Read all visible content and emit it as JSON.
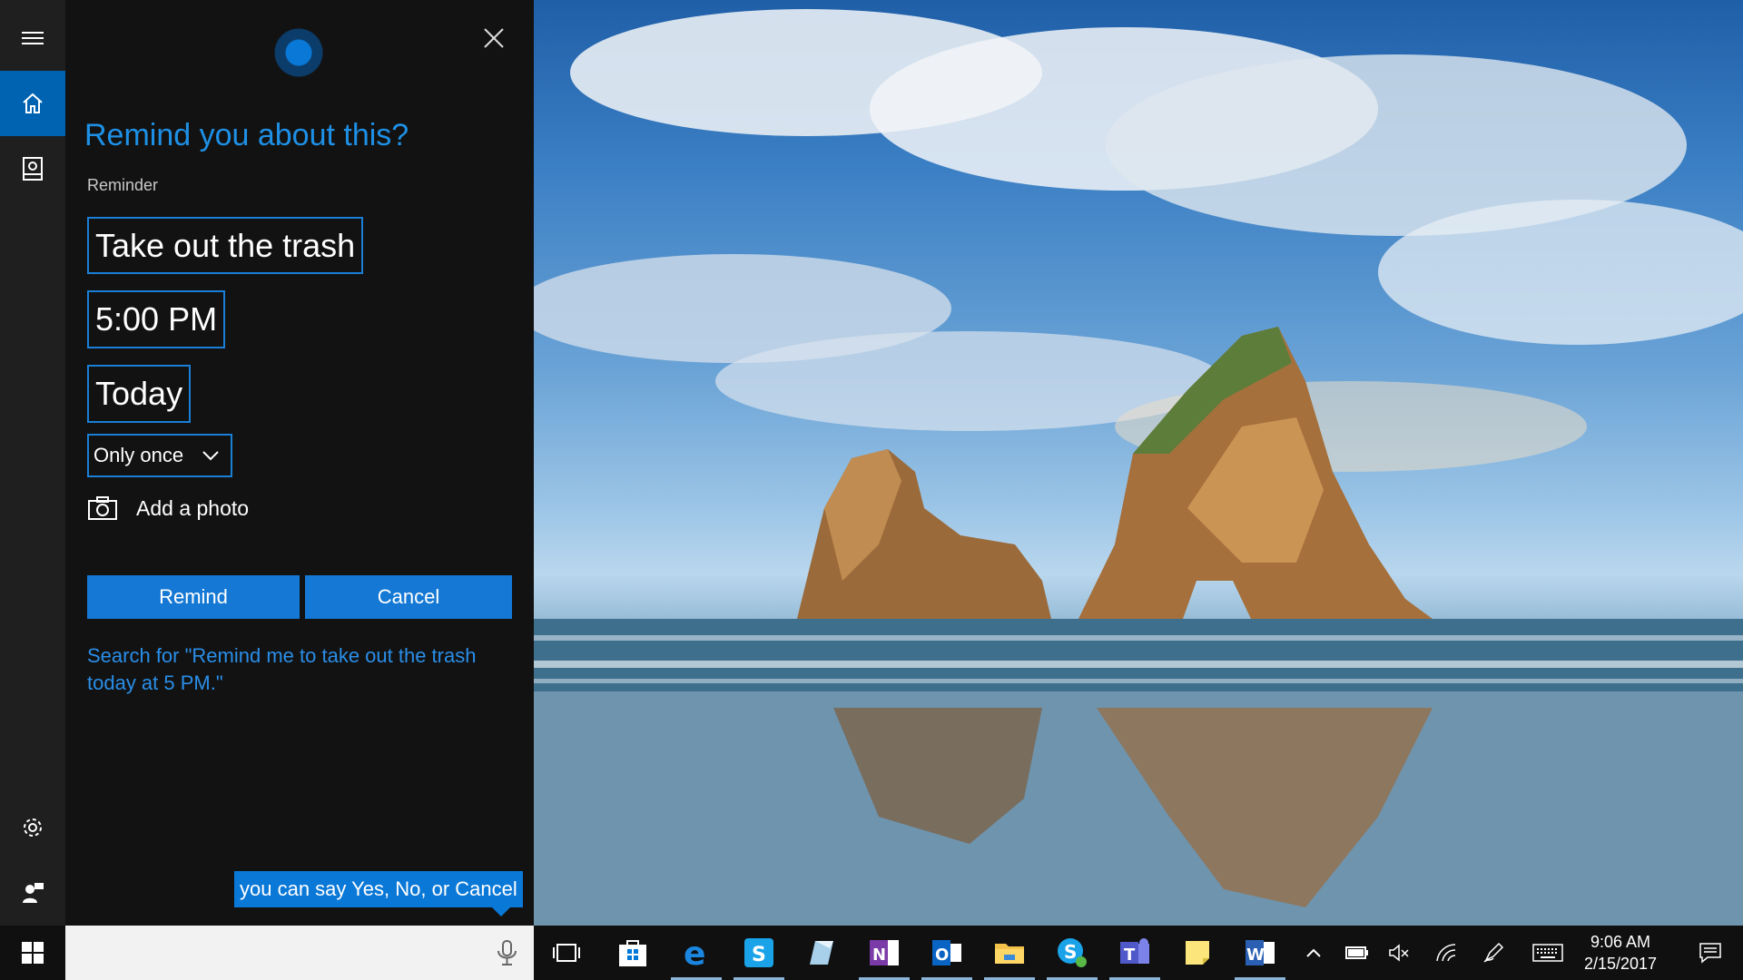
{
  "cortana": {
    "title": "Remind you about this?",
    "section_label": "Reminder",
    "task_value": "Take out the trash",
    "time_value": "5:00 PM",
    "day_value": "Today",
    "repeat_value": "Only once",
    "add_photo_label": "Add a photo",
    "remind_label": "Remind",
    "cancel_label": "Cancel",
    "search_hint": "Search for \"Remind me to take out the trash today at 5 PM.\"",
    "speech_tip": "you can say Yes, No, or Cancel"
  },
  "rail": {
    "items": [
      {
        "icon": "hamburger-menu-icon"
      },
      {
        "icon": "home-icon",
        "active": true
      },
      {
        "icon": "notebook-icon"
      },
      {
        "icon": "gear-icon"
      },
      {
        "icon": "feedback-icon"
      }
    ]
  },
  "taskbar": {
    "pinned": [
      "task-view-icon",
      "store-icon",
      "edge-icon",
      "skype-icon",
      "paint3d-icon",
      "onenote-icon",
      "outlook-icon",
      "file-explorer-icon",
      "skype-business-icon",
      "teams-icon",
      "sticky-notes-icon",
      "word-icon"
    ],
    "tray": [
      "chevron-up-icon",
      "battery-icon",
      "volume-muted-icon",
      "wifi-icon",
      "pen-icon",
      "keyboard-icon"
    ],
    "time": "9:06 AM",
    "date": "2/15/2017"
  },
  "colors": {
    "accent": "#0a78d7",
    "link": "#2a8ee8",
    "panel_bg": "#121212",
    "rail_bg": "#1f1f1f",
    "taskbar_bg": "#101010"
  }
}
